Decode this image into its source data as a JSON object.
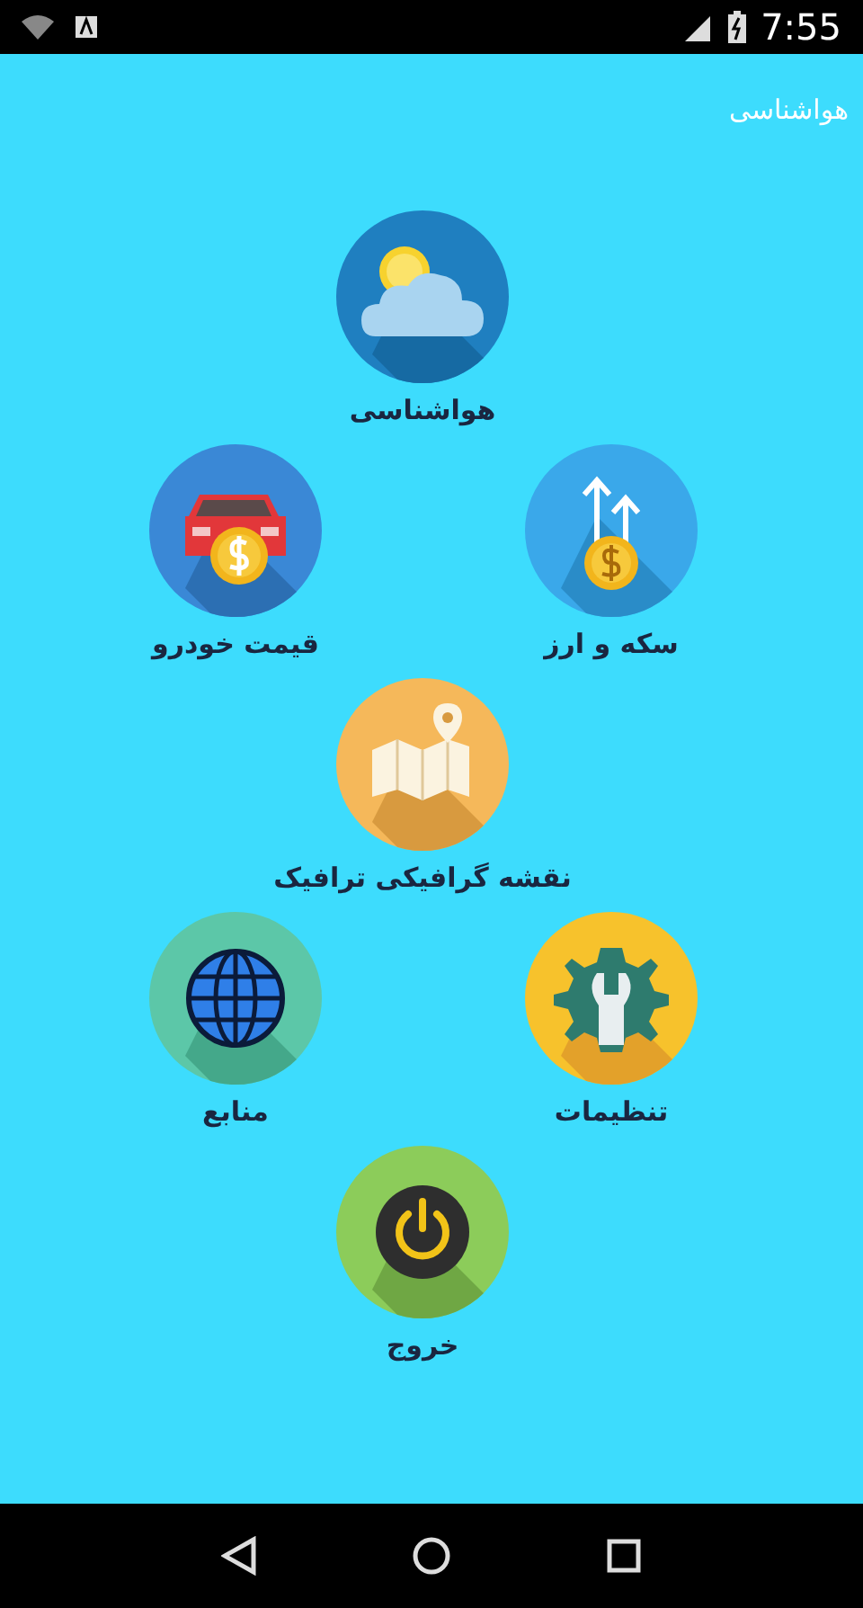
{
  "status_bar": {
    "time": "7:55"
  },
  "app_bar": {
    "title": "هواشناسی"
  },
  "rows": [
    [
      {
        "kind": "weather",
        "label": "هواشناسی"
      }
    ],
    [
      {
        "kind": "currency",
        "label": "سکه و ارز"
      },
      {
        "kind": "car-price",
        "label": "قیمت خودرو"
      }
    ],
    [
      {
        "kind": "map",
        "label": "نقشه گرافیکی ترافیک"
      }
    ],
    [
      {
        "kind": "settings",
        "label": "تنظیمات"
      },
      {
        "kind": "globe",
        "label": "منابع"
      }
    ],
    [
      {
        "kind": "power",
        "label": "خروج"
      }
    ]
  ]
}
